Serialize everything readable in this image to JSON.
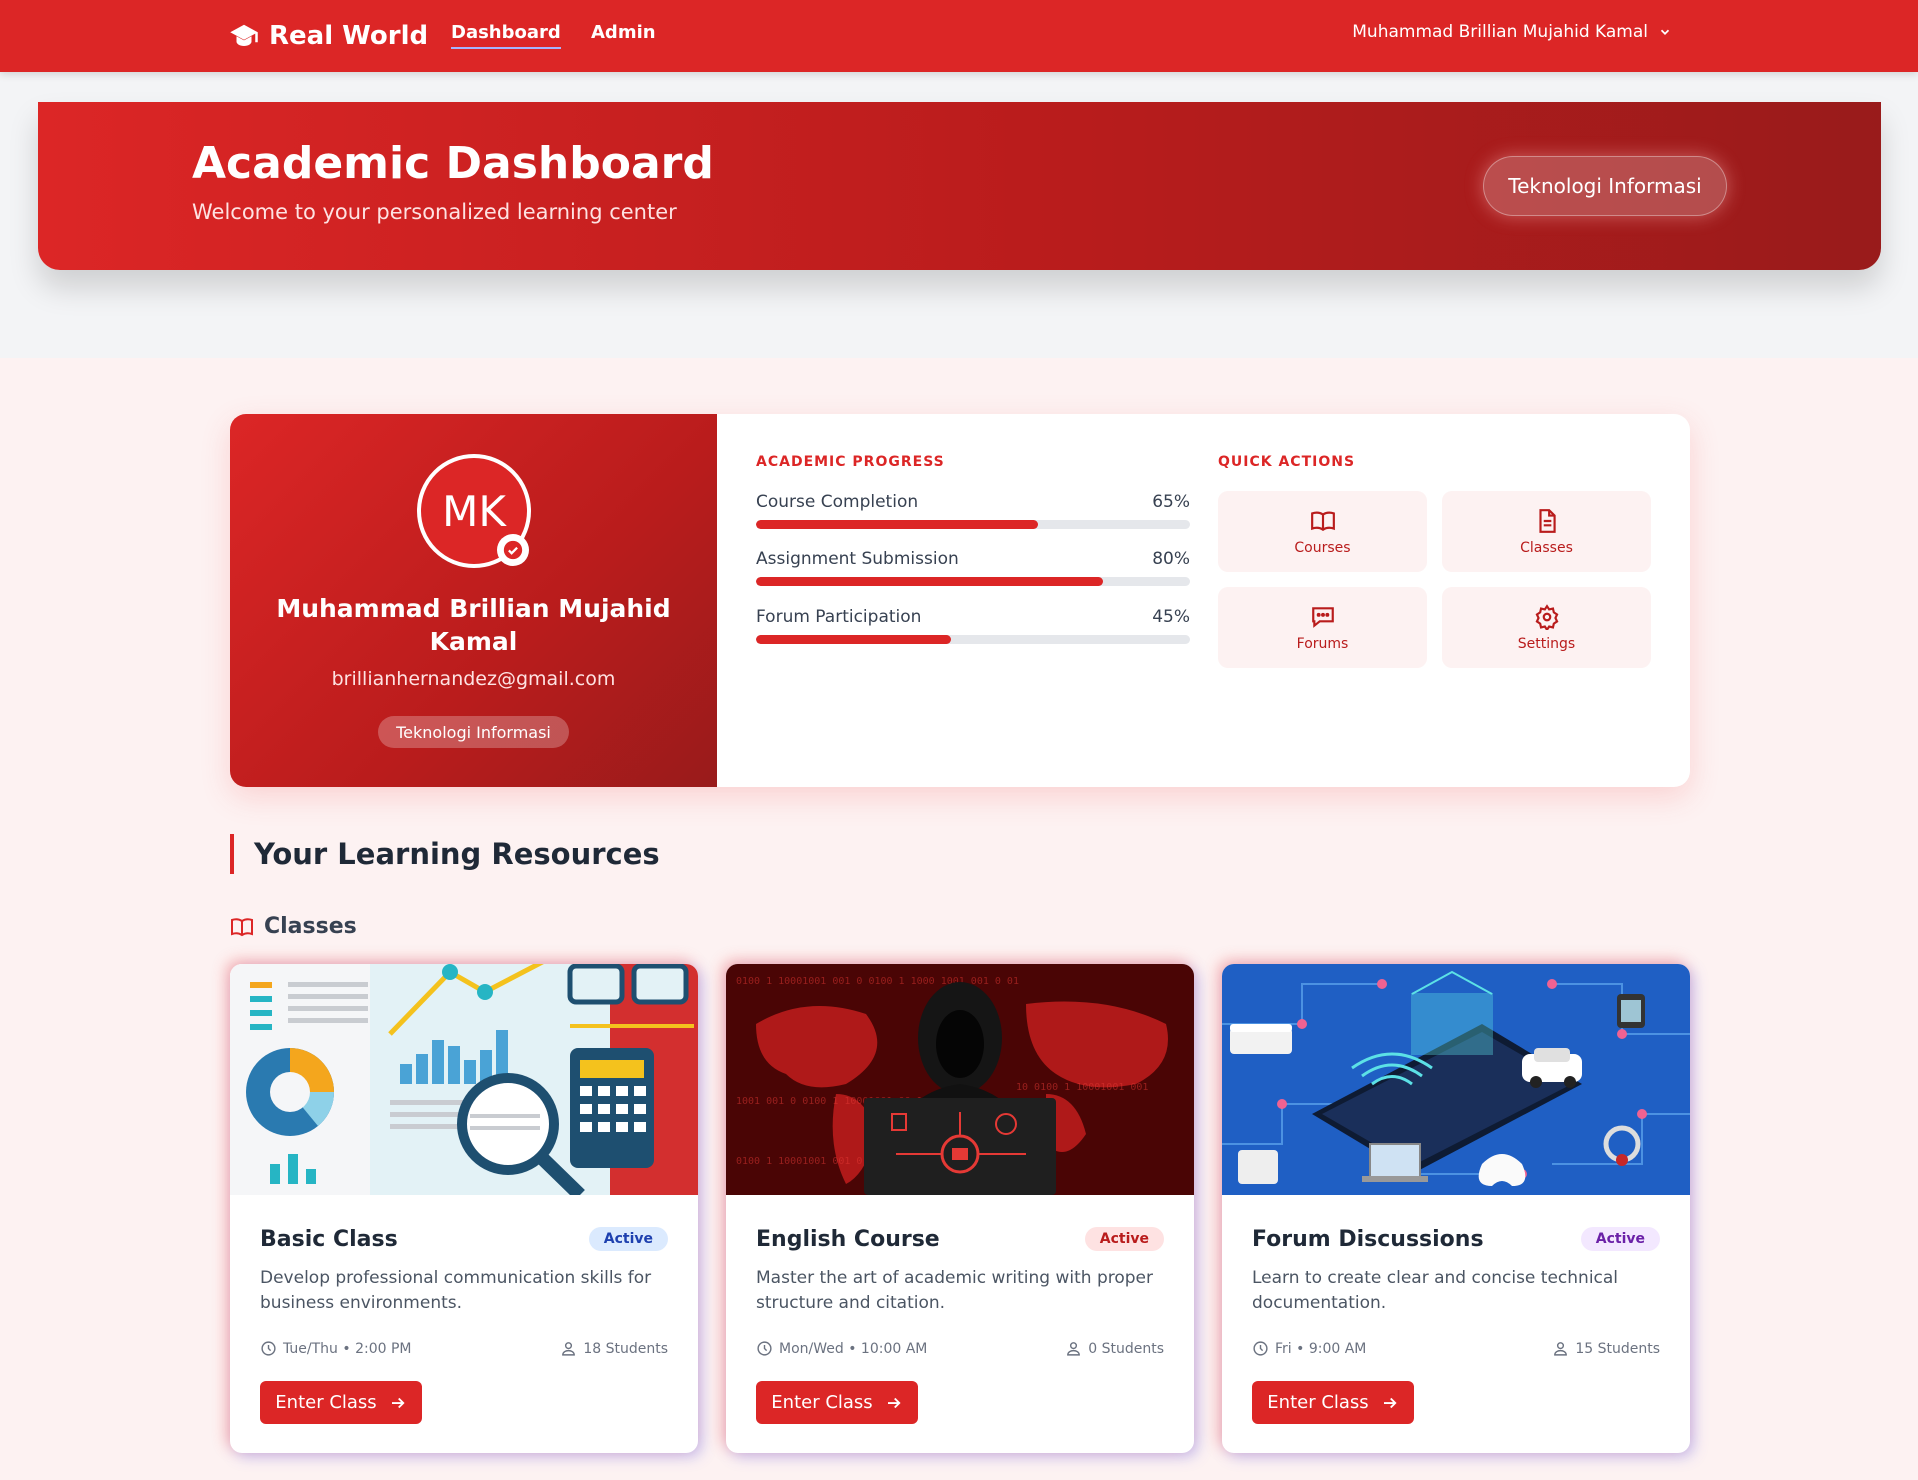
{
  "navbar": {
    "brand": "Real World",
    "links": [
      "Dashboard",
      "Admin"
    ],
    "active_link": "Dashboard",
    "user_name": "Muhammad Brillian Mujahid Kamal"
  },
  "hero": {
    "title": "Academic Dashboard",
    "subtitle": "Welcome to your personalized learning center",
    "badge": "Teknologi Informasi"
  },
  "profile": {
    "initials": "MK",
    "name": "Muhammad Brillian Mujahid Kamal",
    "email": "brillianhernandez@gmail.com",
    "department": "Teknologi Informasi"
  },
  "progress": {
    "heading": "ACADEMIC PROGRESS",
    "items": [
      {
        "label": "Course Completion",
        "value": "65%",
        "fraction": 0.65
      },
      {
        "label": "Assignment Submission",
        "value": "80%",
        "fraction": 0.8
      },
      {
        "label": "Forum Participation",
        "value": "45%",
        "fraction": 0.45
      }
    ]
  },
  "quick_actions": {
    "heading": "QUICK ACTIONS",
    "items": [
      {
        "label": "Courses",
        "icon": "book-open-icon"
      },
      {
        "label": "Classes",
        "icon": "document-icon"
      },
      {
        "label": "Forums",
        "icon": "chat-icon"
      },
      {
        "label": "Settings",
        "icon": "gear-icon"
      }
    ]
  },
  "resources": {
    "title": "Your Learning Resources",
    "classes_heading": "Classes",
    "cards": [
      {
        "title": "Basic Class",
        "status": "Active",
        "status_color": "#1e40af",
        "status_bg": "#dbeafe",
        "description": "Develop professional communication skills for business environments.",
        "schedule": "Tue/Thu • 2:00 PM",
        "students": "18 Students",
        "button": "Enter Class"
      },
      {
        "title": "English Course",
        "status": "Active",
        "status_color": "#b91c1c",
        "status_bg": "#fee2e2",
        "description": "Master the art of academic writing with proper structure and citation.",
        "schedule": "Mon/Wed • 10:00 AM",
        "students": "0 Students",
        "button": "Enter Class"
      },
      {
        "title": "Forum Discussions",
        "status": "Active",
        "status_color": "#6b21a8",
        "status_bg": "#f3e8ff",
        "description": "Learn to create clear and concise technical documentation.",
        "schedule": "Fri • 9:00 AM",
        "students": "15 Students",
        "button": "Enter Class"
      }
    ]
  },
  "colors": {
    "primary": "#dc2626",
    "primary_dark": "#991b1b",
    "page_bg": "#fdf2f2"
  }
}
